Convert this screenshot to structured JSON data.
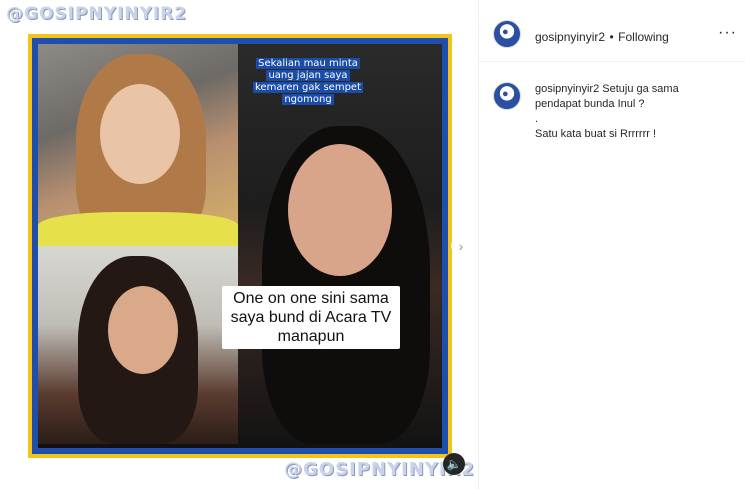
{
  "post": {
    "watermark_top": "@GOSIPNYINYIR2",
    "watermark_bottom": "@GOSIPNYINYIR2",
    "video_caption_top": "Sekalian mau minta uang jajan saya kemaren gak sempet ngomong",
    "video_caption_main": "One on one sini sama saya bund di Acara TV manapun",
    "next_icon": "chevron-right-icon",
    "sound_icon": "speaker-muted-icon",
    "colors": {
      "frame_yellow": "#f2c318",
      "frame_blue": "#1f4fae"
    }
  },
  "header": {
    "username": "gosipnyinyir2",
    "separator": "•",
    "follow_status": "Following",
    "more_label": "···"
  },
  "caption": {
    "username": "gosipnyinyir2",
    "line1": "Setuju ga sama pendapat bunda Inul ?",
    "line2": ".",
    "line3": "Satu kata buat si Rrrrrrr !"
  }
}
